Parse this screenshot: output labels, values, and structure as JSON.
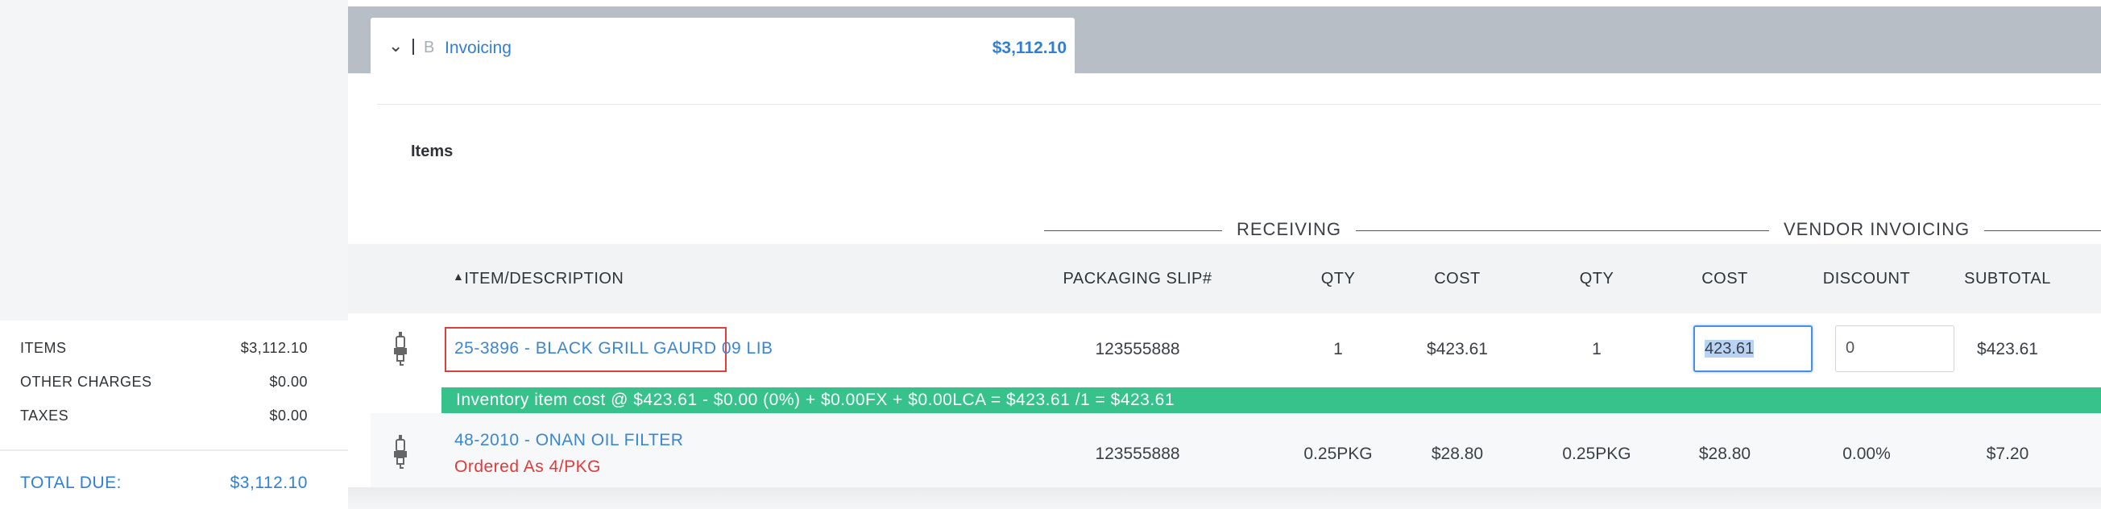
{
  "summary": {
    "items_label": "ITEMS",
    "items_value": "$3,112.10",
    "other_label": "OTHER CHARGES",
    "other_value": "$0.00",
    "taxes_label": "TAXES",
    "taxes_value": "$0.00",
    "total_label": "TOTAL DUE:",
    "total_value": "$3,112.10"
  },
  "tab": {
    "letter": "B",
    "label": "Invoicing",
    "amount": "$3,112.10"
  },
  "items_title": "Items",
  "groups": {
    "receiving": "RECEIVING",
    "vendor": "VENDOR INVOICING"
  },
  "headers": {
    "item": "ITEM/DESCRIPTION",
    "slip": "PACKAGING SLIP#",
    "r_qty": "QTY",
    "r_cost": "COST",
    "v_qty": "QTY",
    "v_cost": "COST",
    "discount": "DISCOUNT",
    "subtotal": "SUBTOTAL"
  },
  "rows": [
    {
      "item": "25-3896 - BLACK GRILL GAURD 09 LIB",
      "slip": "123555888",
      "r_qty": "1",
      "r_cost": "$423.61",
      "v_qty": "1",
      "v_cost_input": "423.61",
      "discount_input": "0",
      "subtotal": "$423.61",
      "banner": "Inventory item cost @ $423.61 - $0.00 (0%) + $0.00FX + $0.00LCA = $423.61 /1 = $423.61"
    },
    {
      "item": "48-2010 - ONAN OIL FILTER",
      "note": "Ordered As 4/PKG",
      "slip": "123555888",
      "r_qty": "0.25PKG",
      "r_cost": "$28.80",
      "v_qty": "0.25PKG",
      "v_cost": "$28.80",
      "discount": "0.00%",
      "subtotal": "$7.20"
    }
  ]
}
